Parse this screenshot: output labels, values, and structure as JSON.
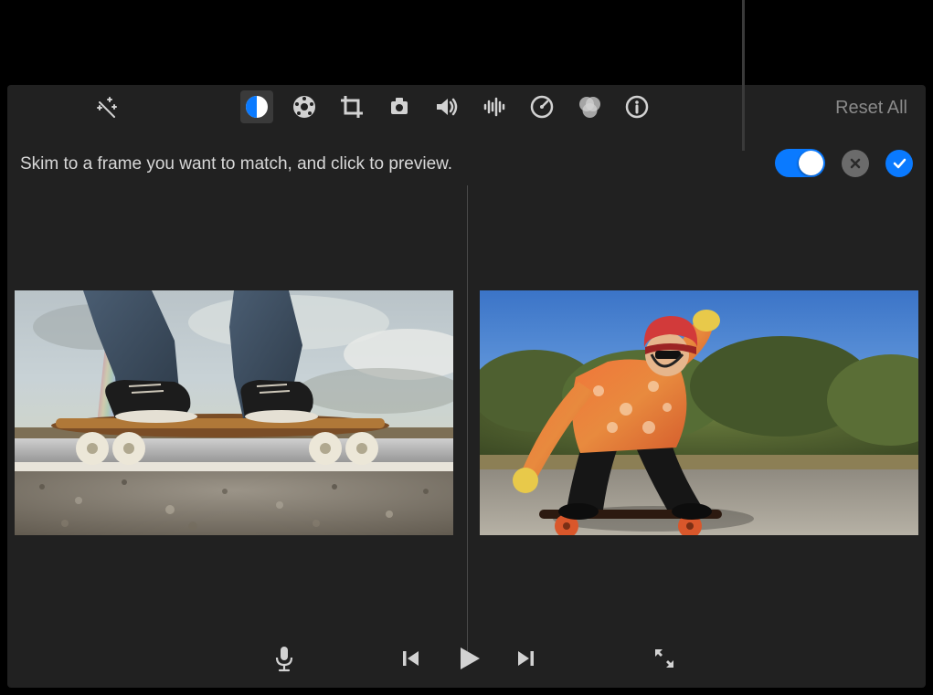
{
  "toolbar": {
    "reset_label": "Reset All",
    "icons": {
      "enhance": "enhance-icon",
      "color_balance": "color-balance-icon",
      "color": "color-icon",
      "crop": "crop-icon",
      "stabilize": "stabilize-icon",
      "volume": "volume-icon",
      "noise": "noise-reduction-icon",
      "speed": "speed-icon",
      "filters": "filters-icon",
      "info": "info-icon"
    }
  },
  "instruction": "Skim to a frame you want to match, and click to preview.",
  "controls": {
    "match_enabled": true
  },
  "transport": {
    "mic": "microphone-icon",
    "prev": "previous-icon",
    "play": "play-icon",
    "next": "next-icon",
    "fullscreen": "fullscreen-icon"
  }
}
